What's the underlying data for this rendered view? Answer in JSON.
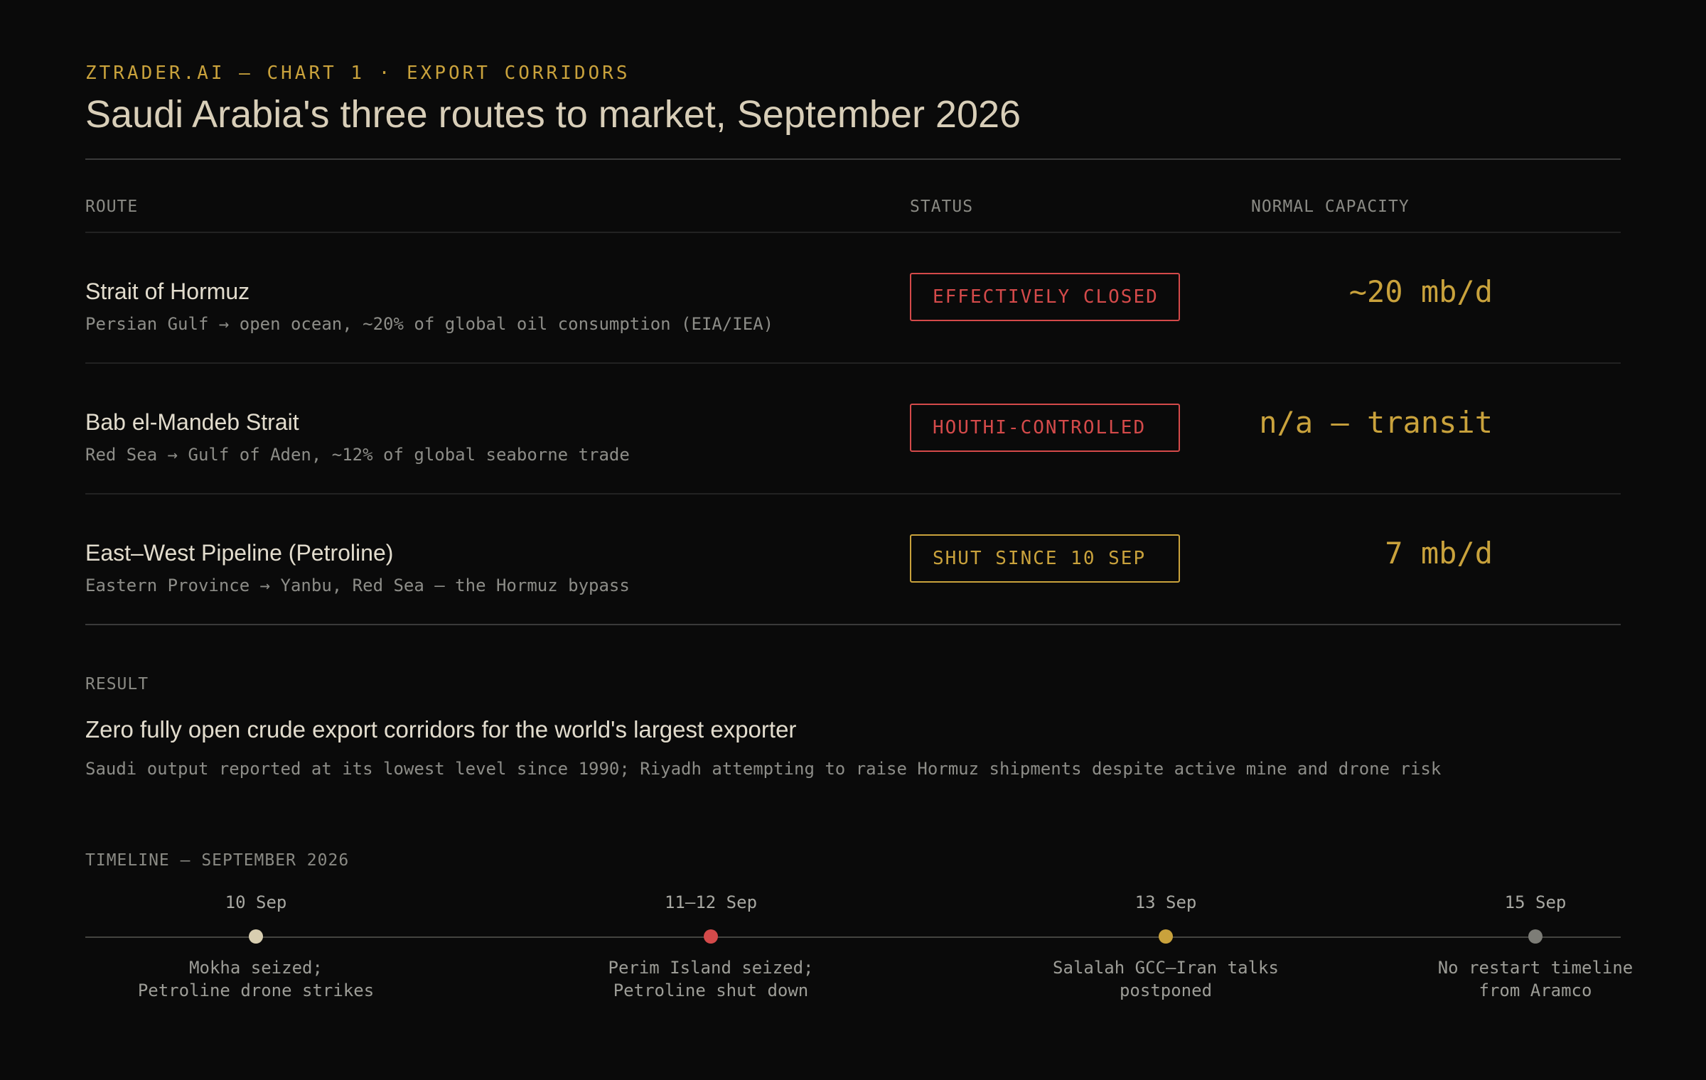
{
  "header": {
    "eyebrow": "ZTRADER.AI — CHART 1 · EXPORT CORRIDORS",
    "title": "Saudi Arabia's three routes to market, September 2026"
  },
  "table": {
    "columns": [
      "ROUTE",
      "STATUS",
      "NORMAL CAPACITY"
    ],
    "rows": [
      {
        "name": "Strait of Hormuz",
        "description": "Persian Gulf → open ocean, ~20% of global oil consumption (EIA/IEA)",
        "status": "EFFECTIVELY CLOSED",
        "status_color": "#d44a4a",
        "capacity": "~20 mb/d"
      },
      {
        "name": "Bab el-Mandeb Strait",
        "description": "Red Sea → Gulf of Aden, ~12% of global seaborne trade",
        "status": "HOUTHI-CONTROLLED",
        "status_color": "#d44a4a",
        "capacity": "n/a — transit"
      },
      {
        "name": "East–West Pipeline (Petroline)",
        "description": "Eastern Province → Yanbu, Red Sea — the Hormuz bypass",
        "status": "SHUT SINCE 10 SEP",
        "status_color": "#c9a23c",
        "capacity": "7 mb/d"
      }
    ]
  },
  "result": {
    "label": "RESULT",
    "headline": "Zero fully open crude export corridors for the world's largest exporter",
    "detail": "Saudi output reported at its lowest level since 1990; Riyadh attempting to raise Hormuz shipments despite active mine and drone risk"
  },
  "timeline": {
    "label": "TIMELINE — SEPTEMBER 2026",
    "events": [
      {
        "date": "10 Sep",
        "line1": "Mokha seized;",
        "line2": "Petroline drone strikes",
        "dot_color": "#d8ceb0"
      },
      {
        "date": "11–12 Sep",
        "line1": "Perim Island seized;",
        "line2": "Petroline shut down",
        "dot_color": "#d44a4a"
      },
      {
        "date": "13 Sep",
        "line1": "Salalah GCC–Iran talks",
        "line2": "postponed",
        "dot_color": "#c9a23c"
      },
      {
        "date": "15 Sep",
        "line1": "No restart timeline",
        "line2": "from Aramco",
        "dot_color": "#7d7d77"
      }
    ]
  },
  "colors": {
    "background": "#0a0a0a",
    "accent": "#c9a23c",
    "alert": "#d44a4a",
    "text": "#e2dccd",
    "muted": "#8d8d88"
  }
}
